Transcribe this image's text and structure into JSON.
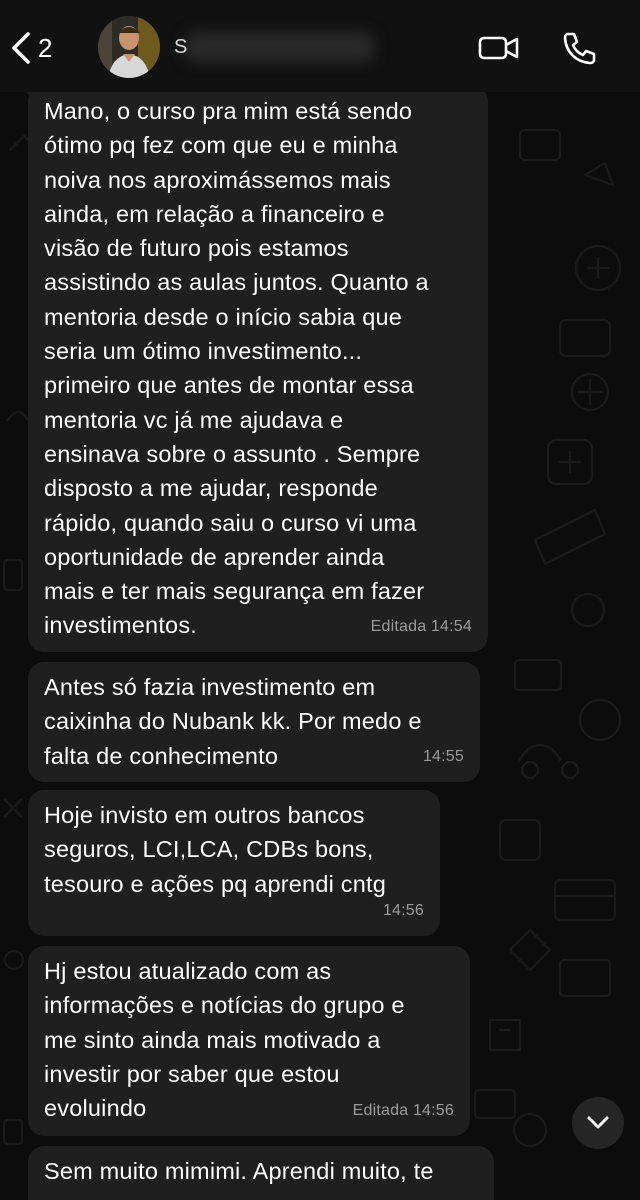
{
  "header": {
    "back_count": "2",
    "contact_name": "S"
  },
  "messages": [
    {
      "text": "Mano, o curso pra mim está sendo\nótimo pq fez com que eu e minha\nnoiva nos aproximássemos mais\nainda, em relação a financeiro e\nvisão de futuro pois estamos\nassistindo as aulas juntos. Quanto a\nmentoria desde o início sabia que\nseria um ótimo investimento...\nprimeiro que antes de montar essa\nmentoria vc já me ajudava e\nensinava sobre o assunto . Sempre\ndisposto a me ajudar, responde\nrápido, quando saiu o curso vi uma\noportunidade de aprender ainda\nmais e ter mais segurança em fazer\ninvestimentos.",
      "meta": "Editada 14:54"
    },
    {
      "text": "Antes só fazia investimento em\ncaixinha do Nubank kk. Por medo e\nfalta de conhecimento",
      "meta": "14:55"
    },
    {
      "text": "Hoje invisto em outros bancos\nseguros, LCI,LCA, CDBs bons,\ntesouro e ações pq aprendi cntg",
      "meta": "14:56"
    },
    {
      "text": "Hj estou atualizado com as\ninformações e notícias do grupo e\nme sinto ainda mais motivado a\ninvestir por saber que estou\nevoluindo",
      "meta": "Editada 14:56"
    },
    {
      "text": "Sem muito mimimi. Aprendi muito, te",
      "meta": ""
    }
  ],
  "icons": {
    "back": "chevron-left-icon",
    "video": "video-camera-icon",
    "call": "phone-icon",
    "scroll_down": "chevron-down-icon"
  },
  "colors": {
    "background": "#0c0c0c",
    "header": "#111111",
    "bubble": "#1f1f1f",
    "text": "#ffffff",
    "meta": "#9a9a9a"
  }
}
